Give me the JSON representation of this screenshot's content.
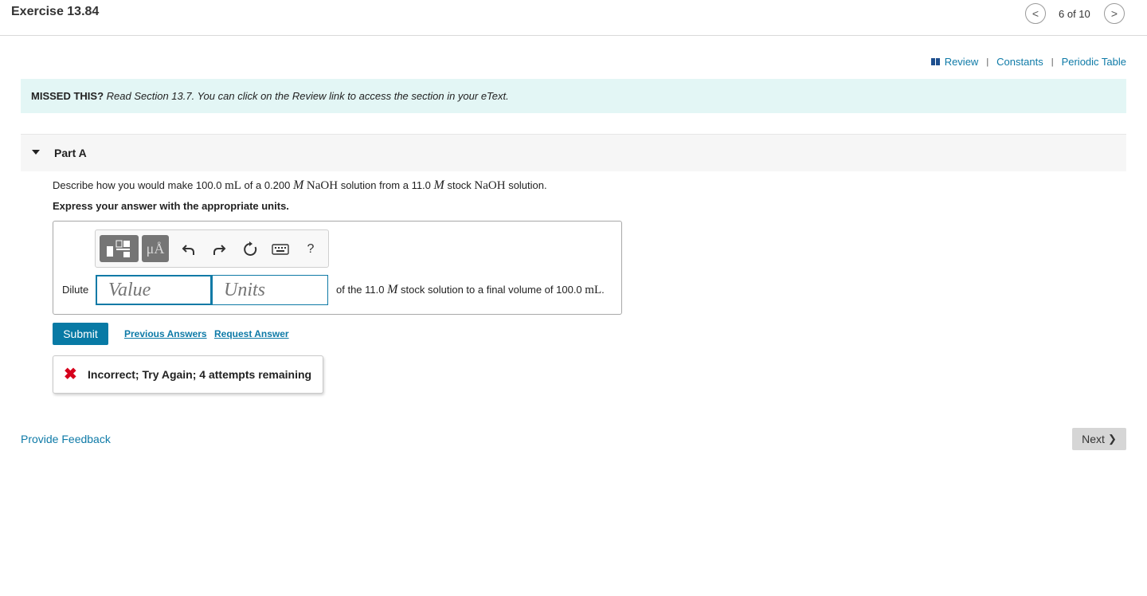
{
  "header": {
    "title": "Exercise 13.84",
    "counter": "6 of 10",
    "prev_glyph": "<",
    "next_glyph": ">"
  },
  "top_links": {
    "review": "Review",
    "constants": "Constants",
    "periodic_table": "Periodic Table",
    "separator": "|"
  },
  "missed": {
    "label": "MISSED THIS?",
    "text": "Read Section 13.7. You can click on the Review link to access the section in your eText."
  },
  "part": {
    "label": "Part A",
    "question": {
      "pre": "Describe how you would make 100.0 ",
      "unit_ml": "mL",
      "mid1": " of a 0.200 ",
      "unit_m": "M",
      "sp": " ",
      "naoh": "NaOH",
      "mid2": " solution from a 11.0 ",
      "mid3": " stock ",
      "end": " solution."
    },
    "instruction": "Express your answer with the appropriate units."
  },
  "answer": {
    "prefix": "Dilute",
    "value_placeholder": "Value",
    "units_placeholder": "Units",
    "suffix_pre": "of the 11.0 ",
    "suffix_m": "M",
    "suffix_mid": " stock solution to a final volume of 100.0 ",
    "suffix_unit": "mL",
    "suffix_end": ".",
    "toolbar": {
      "units_glyph": "μÅ",
      "help": "?"
    }
  },
  "actions": {
    "submit": "Submit",
    "previous_answers": "Previous Answers",
    "request_answer": "Request Answer"
  },
  "feedback": {
    "icon": "✖",
    "text": "Incorrect; Try Again; 4 attempts remaining",
    "color": "#d6001c"
  },
  "footer": {
    "provide_feedback": "Provide Feedback",
    "next": "Next",
    "next_glyph": "❯"
  },
  "colors": {
    "accent": "#087aa5",
    "banner_bg": "#e3f6f5",
    "link": "#0e7aa7"
  }
}
